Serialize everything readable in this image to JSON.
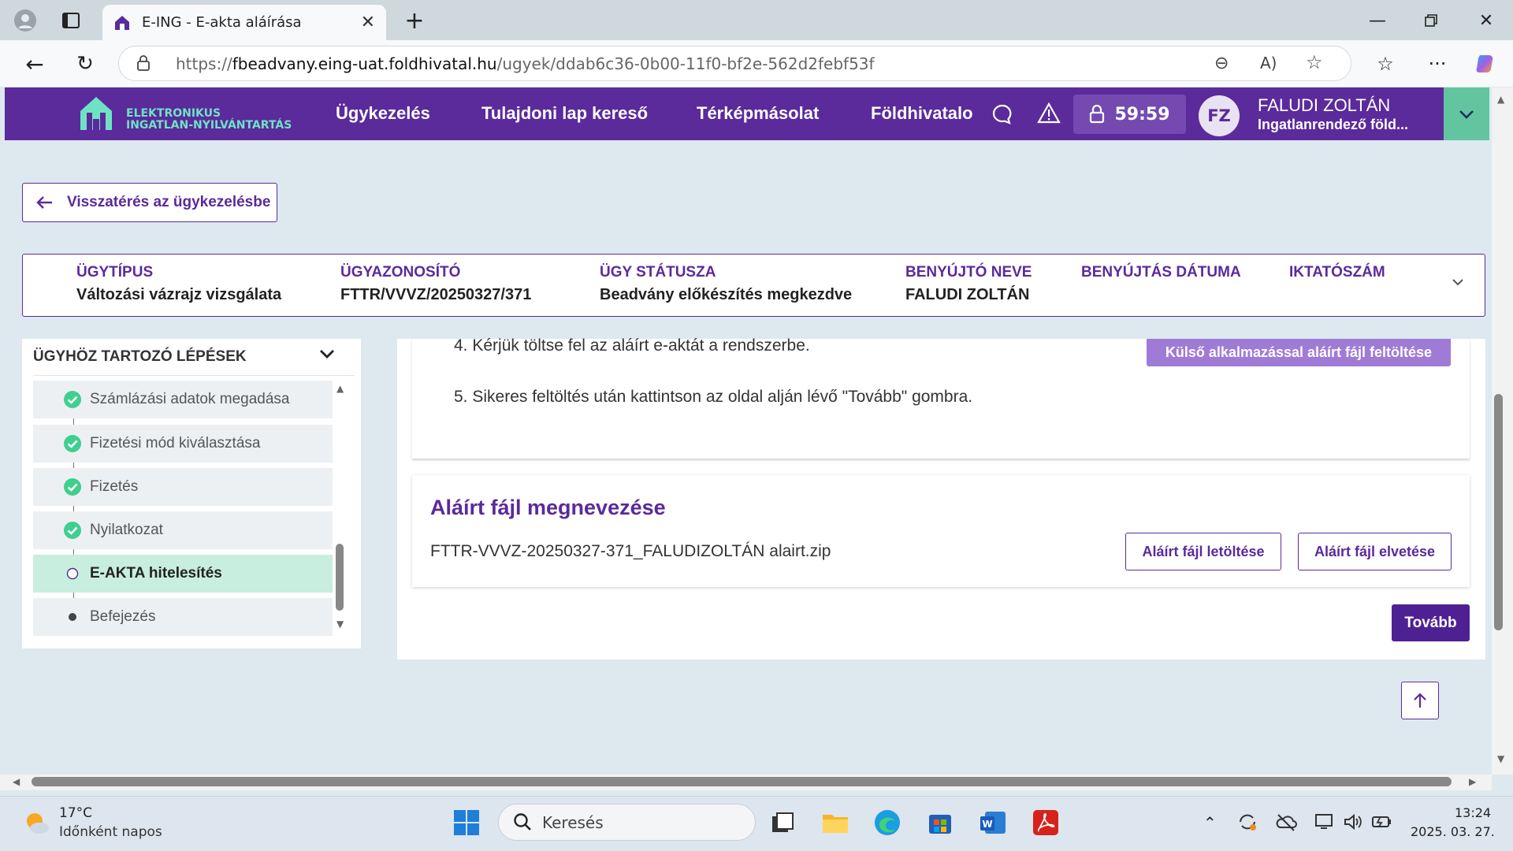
{
  "browser": {
    "tab_title": "E-ING - E-akta aláírása",
    "url_prefix": "https://",
    "url_host": "fbeadvany.eing-uat.foldhivatal.hu",
    "url_path": "/ugyek/ddab6c36-0b00-11f0-bf2e-562d2febf53f"
  },
  "header": {
    "logo_line1": "ELEKTRONIKUS",
    "logo_line2": "INGATLAN-NYILVÁNTARTÁS",
    "nav": [
      "Ügykezelés",
      "Tulajdoni lap kereső",
      "Térképmásolat",
      "Földhivatalo"
    ],
    "timer": "59:59",
    "avatar_initials": "FZ",
    "user_name": "FALUDI ZOLTÁN",
    "user_org": "Ingatlanrendező föld..."
  },
  "back_button": "Visszatérés az ügykezelésbe",
  "info": {
    "type_label": "ÜGYTÍPUS",
    "type_value": "Változási vázrajz vizsgálata",
    "id_label": "ÜGYAZONOSÍTÓ",
    "id_value": "FTTR/VVVZ/20250327/371",
    "status_label": "ÜGY STÁTUSZA",
    "status_value": "Beadvány előkészítés megkezdve",
    "submitter_label": "BENYÚJTÓ NEVE",
    "submitter_value": "FALUDI ZOLTÁN",
    "date_label": "BENYÚJTÁS DÁTUMA",
    "filing_label": "IKTATÓSZÁM"
  },
  "steps": {
    "title": "ÜGYHÖZ TARTOZÓ LÉPÉSEK",
    "items": [
      {
        "label": "Számlázási adatok megadása",
        "state": "done"
      },
      {
        "label": "Fizetési mód kiválasztása",
        "state": "done"
      },
      {
        "label": "Fizetés",
        "state": "done"
      },
      {
        "label": "Nyilatkozat",
        "state": "done"
      },
      {
        "label": "E-AKTA hitelesítés",
        "state": "current"
      },
      {
        "label": "Befejezés",
        "state": "pending"
      }
    ]
  },
  "main": {
    "instruction_4": "4. Kérjük töltse fel az aláírt e-aktát a rendszerbe.",
    "instruction_5": "5. Sikeres feltöltés után kattintson az oldal alján lévő \"Tovább\" gombra.",
    "upload_button": "Külső alkalmazással aláírt fájl feltöltése",
    "signed_title": "Aláírt fájl megnevezése",
    "signed_filename": "FTTR-VVVZ-20250327-371_FALUDIZOLTÁN alairt.zip",
    "download_button": "Aláírt fájl letöltése",
    "discard_button": "Aláírt fájl elvetése",
    "next_button": "Tovább"
  },
  "taskbar": {
    "weather_temp": "17°C",
    "weather_desc": "Időnként napos",
    "search_placeholder": "Keresés",
    "time": "13:24",
    "date": "2025. 03. 27."
  },
  "colors": {
    "brand_purple": "#5b2a9b",
    "accent_green": "#63c5a0",
    "active_step_bg": "#c7eedf"
  }
}
